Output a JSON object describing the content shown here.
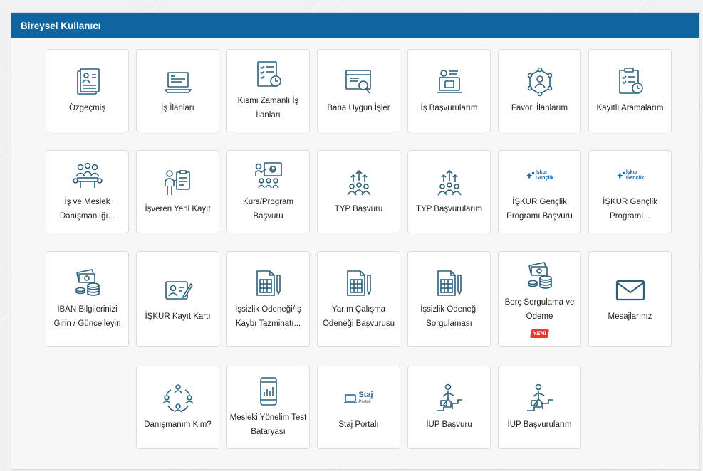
{
  "panel": {
    "title": "Bireysel Kullanıcı"
  },
  "tiles": {
    "ozgecmis": "Özgeçmiş",
    "is_ilanlari": "İş İlanları",
    "kismi_zamanli": "Kısmi Zamanlı İş İlanları",
    "bana_uygun": "Bana Uygun İşler",
    "is_basvurularim": "İş Başvurularım",
    "favori_ilanlarim": "Favori İlanlarım",
    "kayitli_aramalarim": "Kayıtlı Aramalarım",
    "is_meslek_danismanligi": "İş ve Meslek Danışmanlığı...",
    "isveren_yeni_kayit": "İşveren Yeni Kayıt",
    "kurs_program_basvuru": "Kurs/Program Başvuru",
    "typ_basvuru": "TYP Başvuru",
    "typ_basvurularim": "TYP Başvurularım",
    "iskur_genclik_basvuru": "İŞKUR Gençlik Programı Başvuru",
    "iskur_genclik_programi": "İŞKUR Gençlik Programı...",
    "iban_bilgileri": "IBAN Bilgilerinizi Girin / Güncelleyin",
    "iskur_kayit_karti": "İŞKUR Kayıt Kartı",
    "issizlik_odenegi_is_kaybi": "İşsizlik Ödeneği/İş Kaybı Tazminatı...",
    "yarim_calisma": "Yarım Çalışma Ödeneği Başvurusu",
    "issizlik_sorgulama": "İşsizlik Ödeneği Sorgulaması",
    "borc_sorgulama": "Borç Sorgulama ve Ödeme",
    "mesajlariniz": "Mesajlarınız",
    "danismanim_kim": "Danışmanım Kim?",
    "mesleki_yonelim": "Mesleki Yönelim Test Bataryası",
    "staj_portali": "Staj Portalı",
    "iup_basvuru": "İUP Başvuru",
    "iup_basvurularim": "İUP Başvurularım"
  },
  "badges": {
    "yeni": "YENİ"
  },
  "logos": {
    "iskur_brand_line1": "İşkur",
    "iskur_brand_line2": "Gençlik",
    "staj_logo_text": "Staj",
    "staj_logo_sub": "Portalı"
  },
  "colors": {
    "header": "#1065a0",
    "icon": "#2a5f7a",
    "badge": "#e53935"
  }
}
